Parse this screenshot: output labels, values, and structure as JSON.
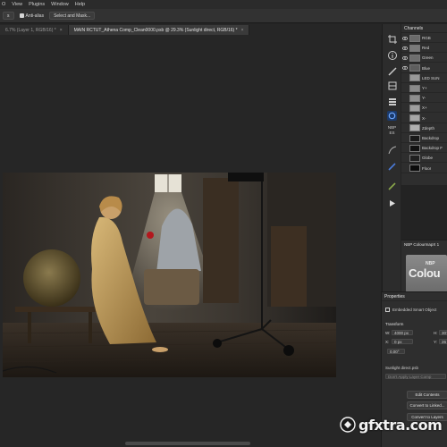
{
  "menubar": {
    "items": [
      "O",
      "View",
      "Plugins",
      "Window",
      "Help"
    ]
  },
  "optionsbar": {
    "button1": "s",
    "antialias_label": "Anti-alias",
    "select_mask_label": "Select and Mask..."
  },
  "tabs": [
    {
      "label": "6.7% (Layer 1, RGB/16) *",
      "close": "×",
      "active": false
    },
    {
      "label": "MAIN RCTUT_Athena Comp_Clean0000.psb @ 29.3% (Sunlight direct, RGB/16) *",
      "close": "×",
      "active": true
    }
  ],
  "right_strip": {
    "nbp_label": "NBP",
    "nbp_sub": "ES"
  },
  "channels": {
    "title": "Channels",
    "rows": [
      {
        "name": "RGB",
        "visible": true
      },
      {
        "name": "Red",
        "visible": true
      },
      {
        "name": "Green",
        "visible": true
      },
      {
        "name": "Blue",
        "visible": true
      },
      {
        "name": "LED SUN",
        "visible": false
      },
      {
        "name": "Y+",
        "visible": false
      },
      {
        "name": "Y-",
        "visible": false
      },
      {
        "name": "X+",
        "visible": false
      },
      {
        "name": "X-",
        "visible": false
      },
      {
        "name": "Zdepth",
        "visible": false
      },
      {
        "name": "Backdrop",
        "visible": false
      },
      {
        "name": "Backdrop F",
        "visible": false
      },
      {
        "name": "Globe",
        "visible": false
      },
      {
        "name": "Floor",
        "visible": false
      }
    ]
  },
  "colourmap": {
    "title": "NBP ColourmapX 1",
    "logo_top": "NBP",
    "logo_big": "Colou"
  },
  "properties": {
    "title": "Properties",
    "object_type": "Embedded Smart Object",
    "transform_label": "Transform",
    "w_label": "W:",
    "w_value": "4000 px",
    "h_label": "H:",
    "h_value": "307",
    "x_label": "X:",
    "x_value": "0 px",
    "y_label": "Y:",
    "y_value": "26",
    "angle_value": "0.00°",
    "file_name": "Sunlight direct.psb",
    "layer_comp_placeholder": "Don't Apply Layer Comp",
    "edit_contents_label": "Edit Contents",
    "convert_linked_label": "Convert to Linked...",
    "convert_layers_label": "Convert to Layers"
  },
  "watermark": {
    "text": "gfxtra.com"
  },
  "colors": {
    "bg": "#232323",
    "panel": "#2e2e2e",
    "accent_blue": "#3a7bd5"
  }
}
